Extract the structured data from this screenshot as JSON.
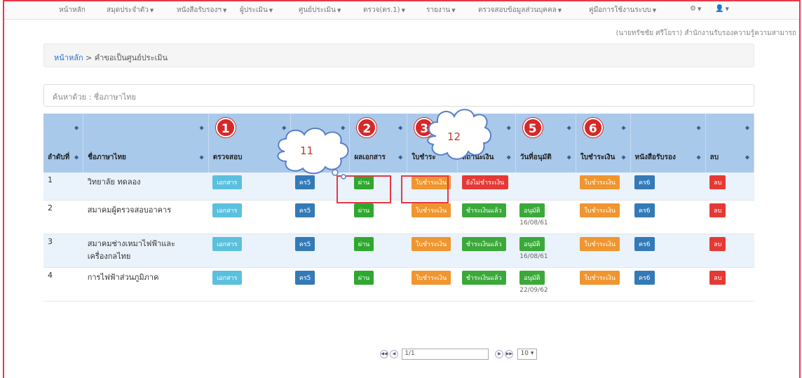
{
  "nav": {
    "items": [
      "หน้าหลัก",
      "สมุดประจำตัว",
      "หนังสือรับรองฯ",
      "ผู้ประเมิน",
      "ศูนย์ประเมิน",
      "ตรวจ(ตร.1)",
      "รายงาน",
      "ตรวจสอบข้อมูลส่วนบุคคล",
      "คู่มือการใช้งานระบบ"
    ],
    "gear": "⚙",
    "user": "👤"
  },
  "user_line": "(นายทรัชชัย ศรีโยรา) สำนักงานรับรองความรู้ความสามารถ",
  "breadcrumb": {
    "home": "หน้าหลัก",
    "sep": ">",
    "current": "คำขอเป็นศูนย์ประเมิน"
  },
  "search": {
    "placeholder": "ค้นหาด้วย : ชื่อภาษาไทย"
  },
  "steps": [
    "1",
    "2",
    "3",
    "5",
    "6"
  ],
  "annotations": [
    "11",
    "12"
  ],
  "table": {
    "headers": [
      "ลำดับที่",
      "ชื่อภาษาไทย",
      "ตรวจสอบ",
      "",
      "ผลเอกสาร",
      "ใบชำระ",
      "สถานะเงิน",
      "วันที่อนุมัติ",
      "ใบชำระเงิน",
      "หนังสือรับรอง",
      "ลบ"
    ],
    "rows": [
      {
        "no": "1",
        "name": "วิทยาลัย ทดลอง",
        "doc": "เอกสาร",
        "kr5": "คร5",
        "pass": "ผ่าน",
        "bill": "ใบชำระเงิน",
        "status": "ยังไม่ชำระเงิน",
        "approve": "",
        "date": "",
        "bill2": "ใบชำระเงิน",
        "kr6": "คร6",
        "del": "ลบ"
      },
      {
        "no": "2",
        "name": "สมาคมผู้ตรวจสอบอาคาร",
        "doc": "เอกสาร",
        "kr5": "คร5",
        "pass": "ผ่าน",
        "bill": "ใบชำระเงิน",
        "status": "ชำระเงินแล้ว",
        "approve": "อนุมัติ",
        "date": "16/08/61",
        "bill2": "ใบชำระเงิน",
        "kr6": "คร6",
        "del": "ลบ"
      },
      {
        "no": "3",
        "name": "สมาคมช่างเหมาไฟฟ้าและเครื่องกลไทย",
        "doc": "เอกสาร",
        "kr5": "คร5",
        "pass": "ผ่าน",
        "bill": "ใบชำระเงิน",
        "status": "ชำระเงินแล้ว",
        "approve": "อนุมัติ",
        "date": "16/08/61",
        "bill2": "ใบชำระเงิน",
        "kr6": "คร6",
        "del": "ลบ"
      },
      {
        "no": "4",
        "name": "การไฟฟ้าส่วนภูมิภาค",
        "doc": "เอกสาร",
        "kr5": "คร5",
        "pass": "ผ่าน",
        "bill": "ใบชำระเงิน",
        "status": "ชำระเงินแล้ว",
        "approve": "อนุมัติ",
        "date": "22/09/62",
        "bill2": "ใบชำระเงิน",
        "kr6": "คร6",
        "del": "ลบ"
      }
    ]
  },
  "pager": {
    "page": "1/1",
    "per_page": "10"
  }
}
